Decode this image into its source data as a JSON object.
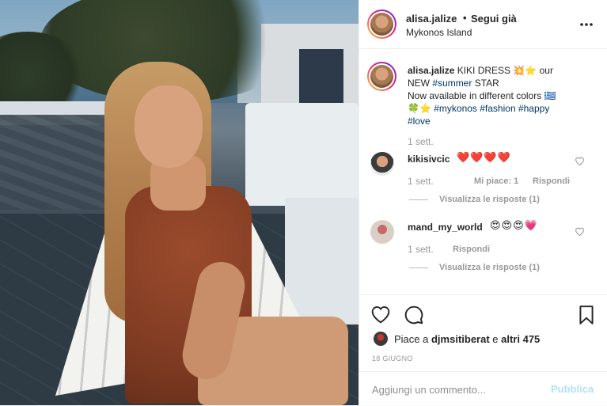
{
  "post": {
    "username": "alisa.jalize",
    "separator": "•",
    "follow_status": "Segui già",
    "location": "Mykonos Island",
    "more": "•••"
  },
  "caption": {
    "username": "alisa.jalize",
    "line1_text": " KIKI DRESS ",
    "line1_emoji": "💥⭐",
    "line1_tail": " our",
    "line2_pre": "NEW ",
    "line2_tag": "#summer",
    "line2_post": " STAR",
    "line3": "Now available in different colors 🇬🇷",
    "line4_emoji": "🍀⭐ ",
    "tags_line": "#mykonos #fashion #happy",
    "last_tag": "#love",
    "time": "1 sett."
  },
  "comments": [
    {
      "username": "kikisivcic",
      "text": "❤️❤️❤️❤️",
      "time": "1 sett.",
      "likes": "Mi piace: 1",
      "reply": "Rispondi",
      "replies_link": "Visualizza le risposte (1)"
    },
    {
      "username": "mand_my_world",
      "text": "😍😍😍💗",
      "time": "1 sett.",
      "reply": "Rispondi",
      "replies_link": "Visualizza le risposte (1)"
    }
  ],
  "actions": {
    "liked_by_prefix": "Piace a ",
    "liked_by_user": "djmsitiberat",
    "liked_by_mid": " e ",
    "liked_by_others": "altri 475",
    "date": "18 GIUGNO"
  },
  "comment_box": {
    "placeholder": "Aggiungi un commento...",
    "publish": "Pubblica"
  },
  "colors": {
    "hashtag": "#003569",
    "publish_disabled": "#b2dffc",
    "secondary_text": "#999999"
  }
}
